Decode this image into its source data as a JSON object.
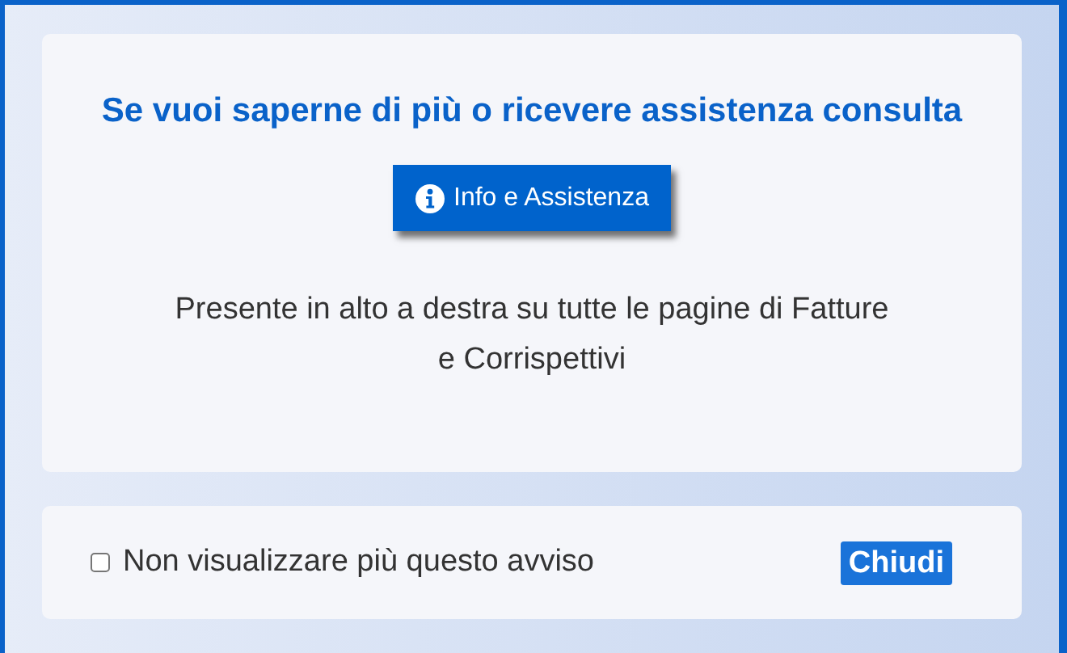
{
  "heading": "Se vuoi saperne di più o ricevere assistenza consulta",
  "info_button": {
    "label": "Info e Assistenza"
  },
  "note": "Presente in alto a destra su tutte le pagine di Fatture e Corrispettivi",
  "dont_show": {
    "label": "Non visualizzare più questo avviso",
    "checked": false
  },
  "close_button": {
    "label": "Chiudi"
  }
}
